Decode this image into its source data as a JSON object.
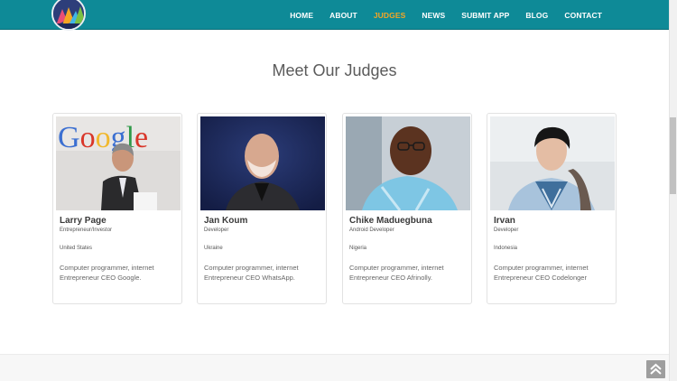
{
  "nav": {
    "items": [
      {
        "label": "HOME",
        "active": false
      },
      {
        "label": "ABOUT",
        "active": false
      },
      {
        "label": "JUDGES",
        "active": true
      },
      {
        "label": "NEWS",
        "active": false
      },
      {
        "label": "SUBMIT APP",
        "active": false
      },
      {
        "label": "BLOG",
        "active": false
      },
      {
        "label": "CONTACT",
        "active": false
      }
    ],
    "active_color": "#f6a623",
    "bar_color": "#0e8a97"
  },
  "section": {
    "title": "Meet Our Judges"
  },
  "judges": [
    {
      "name": "Larry Page",
      "role": "Entrepreneur/Investor",
      "country": "United States",
      "bio": "Computer programmer, internet Entrepreneur CEO Google."
    },
    {
      "name": "Jan Koum",
      "role": "Developer",
      "country": "Ukraine",
      "bio": "Computer programmer, internet Entrepreneur CEO WhatsApp."
    },
    {
      "name": "Chike Maduegbuna",
      "role": "Android Developer",
      "country": "Nigeria",
      "bio": "Computer programmer, internet Entrepreneur CEO Afrinolly."
    },
    {
      "name": "Irvan",
      "role": "Developer",
      "country": "Indonesia",
      "bio": "Computer programmer, internet Entrepreneur CEO Codelonger"
    }
  ],
  "google_logo_text": "Google",
  "icons": {
    "scroll_top": "double-chevron-up-icon"
  }
}
